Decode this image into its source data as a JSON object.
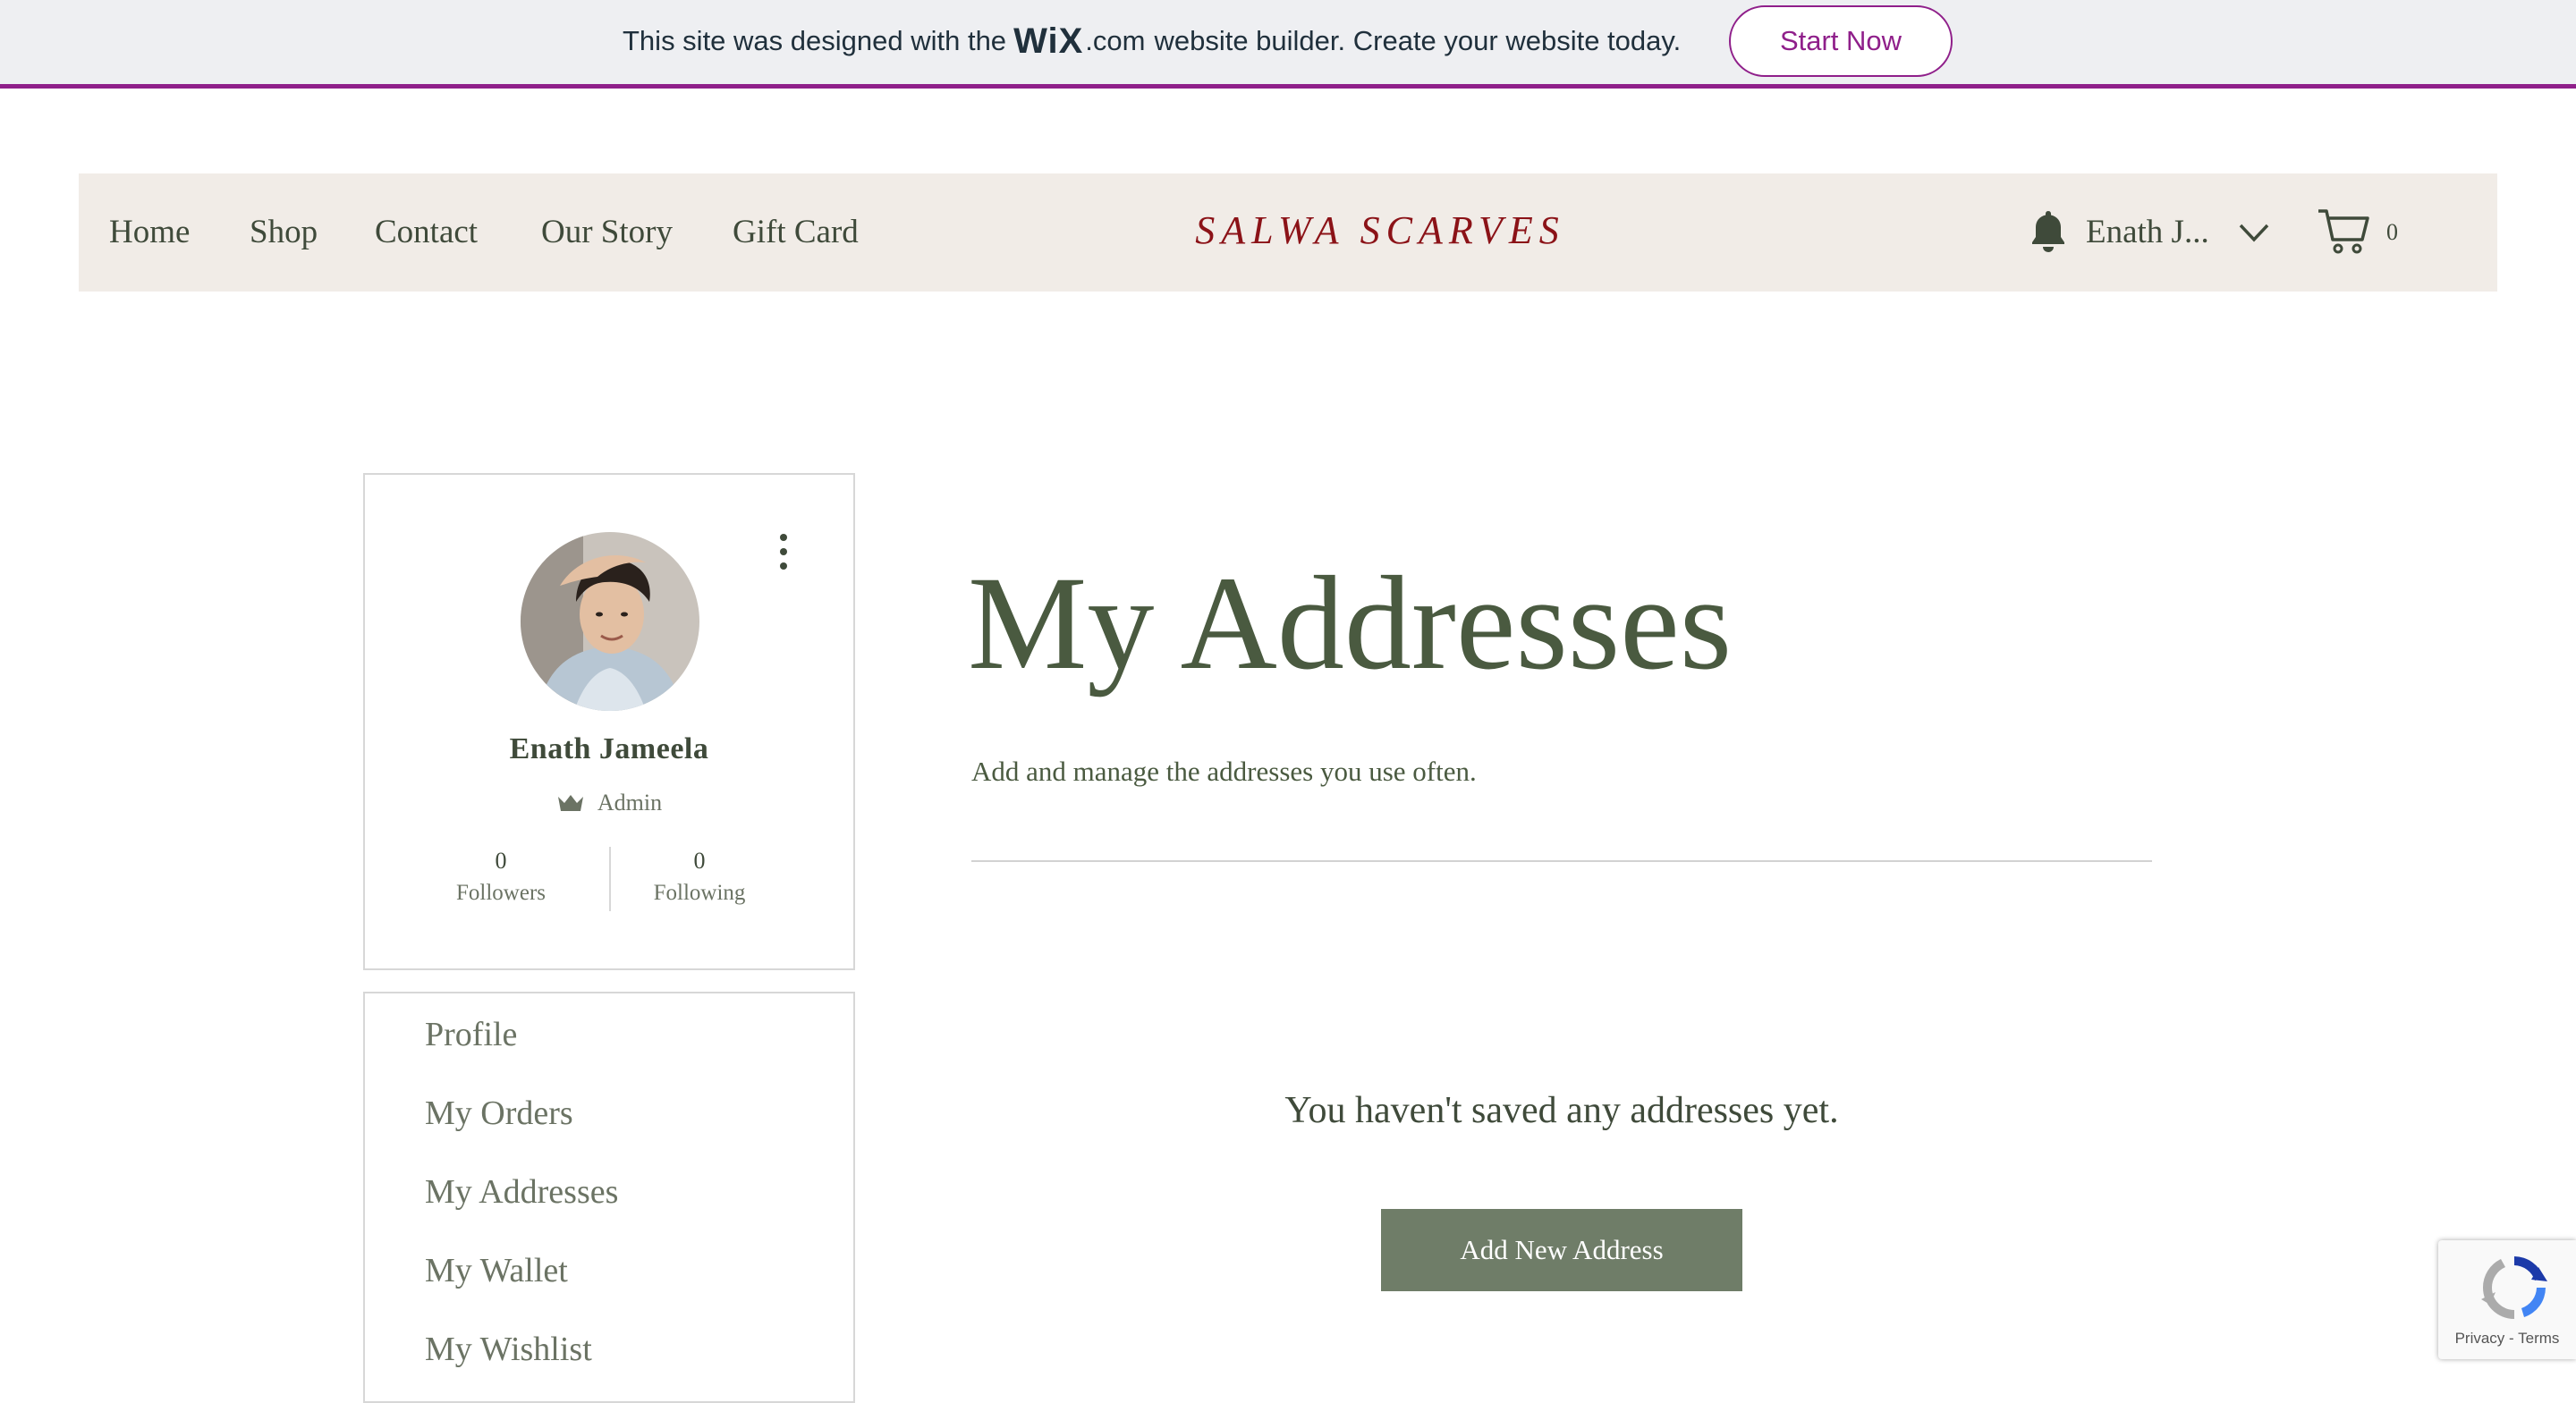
{
  "banner": {
    "text_before": "This site was designed with the",
    "logo_wix": "WiX",
    "logo_dotcom": ".com",
    "text_after": "website builder. Create your website today.",
    "cta_label": "Start Now",
    "accent_color": "#8f1f8a"
  },
  "header": {
    "nav": [
      "Home",
      "Shop",
      "Contact",
      "Our Story",
      "Gift Card"
    ],
    "brand": "SALWA SCARVES",
    "brand_color": "#8b1217",
    "member_name": "Enath J...",
    "cart_count": "0",
    "icons": [
      "bell-icon",
      "chevron-down-icon",
      "cart-icon"
    ]
  },
  "profile": {
    "name": "Enath Jameela",
    "role": "Admin",
    "followers_count": "0",
    "followers_label": "Followers",
    "following_count": "0",
    "following_label": "Following",
    "icons": [
      "avatar",
      "more-vertical-icon",
      "crown-icon"
    ]
  },
  "menu": {
    "items": [
      "Profile",
      "My Orders",
      "My Addresses",
      "My Wallet",
      "My Wishlist"
    ]
  },
  "main": {
    "title": "My Addresses",
    "subtitle": "Add and manage the addresses you use often.",
    "empty_message": "You haven't saved any addresses yet.",
    "add_button_label": "Add New Address",
    "button_color": "#6f7d68",
    "heading_color": "#4a5a40"
  },
  "recaptcha": {
    "privacy": "Privacy",
    "separator": " - ",
    "terms": "Terms"
  }
}
